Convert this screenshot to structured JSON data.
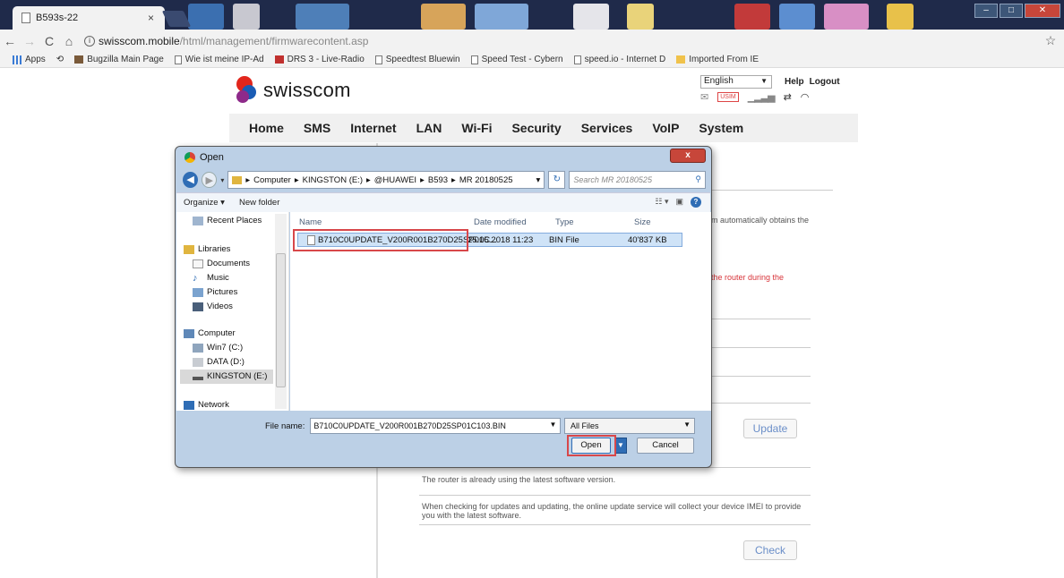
{
  "browser": {
    "tab_title": "B593s-22",
    "tab_close": "×",
    "url_host": "swisscom.mobile",
    "url_path": "/html/management/firmwarecontent.asp",
    "bookmarks": [
      "Apps",
      "Bugzilla Main Page",
      "Wie ist meine IP-Ad",
      "DRS 3 - Live-Radio",
      "Speedtest Bluewin",
      "Speed Test - Cybern",
      "speed.io - Internet D",
      "Imported From IE"
    ]
  },
  "page": {
    "brand": "swisscom",
    "language": "English",
    "help": "Help",
    "logout": "Logout",
    "nav": [
      "Home",
      "SMS",
      "Internet",
      "LAN",
      "Wi-Fi",
      "Security",
      "Services",
      "VoIP",
      "System"
    ],
    "texts": {
      "auto": "m automatically obtains the",
      "router": "the router during the",
      "latest": "The router is already using the latest software version.",
      "imei_1": "When checking for updates and updating, the online update service will collect your device IMEI to provide",
      "imei_2": "you with the latest software."
    },
    "update_button": "Update",
    "check_button": "Check"
  },
  "dialog": {
    "title": "Open",
    "close": "x",
    "breadcrumbs": [
      "Computer",
      "KINGSTON (E:)",
      "@HUAWEI",
      "B593",
      "MR 20180525"
    ],
    "search_placeholder": "Search MR 20180525",
    "organize": "Organize ▾",
    "new_folder": "New folder",
    "nav_items": {
      "recent": "Recent Places",
      "libraries": "Libraries",
      "documents": "Documents",
      "music": "Music",
      "pictures": "Pictures",
      "videos": "Videos",
      "computer": "Computer",
      "win7": "Win7 (C:)",
      "data": "DATA (D:)",
      "kingston": "KINGSTON (E:)",
      "network": "Network"
    },
    "columns": {
      "name": "Name",
      "date": "Date modified",
      "type": "Type",
      "size": "Size"
    },
    "file": {
      "name": "B710C0UPDATE_V200R001B270D25SP01C...",
      "date": "25.05.2018 11:23",
      "type": "BIN File",
      "size": "40'837 KB"
    },
    "filename_label": "File name:",
    "filename_value": "B710C0UPDATE_V200R001B270D25SP01C103.BIN",
    "filter": "All Files",
    "open": "Open",
    "cancel": "Cancel"
  }
}
